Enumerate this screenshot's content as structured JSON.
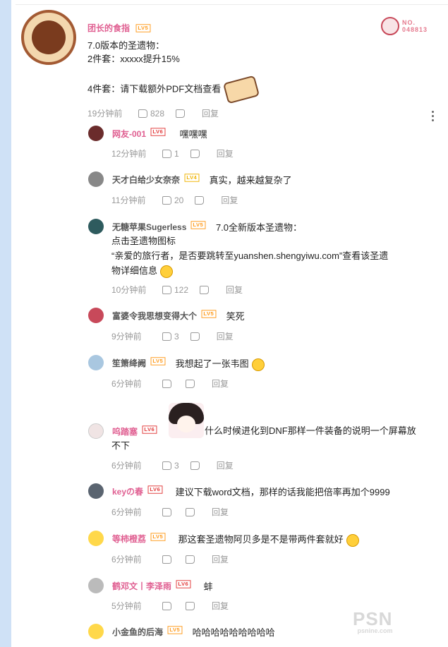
{
  "main": {
    "user": "团长的食指",
    "level": "LV5",
    "lines": [
      "7.0版本的圣遗物：",
      "2件套：xxxxx提升15%",
      "4件套：请下载额外PDF文档查看"
    ],
    "time": "19分钟前",
    "likes": "828",
    "reply_label": "回复",
    "badge_no": "NO.",
    "badge_num": "048813"
  },
  "replies": [
    {
      "user": "网友-001",
      "level": "LV6",
      "text": "嘿嘿嘿",
      "time": "12分钟前",
      "likes": "1",
      "reply_label": "回复"
    },
    {
      "user": "天才白给少女奈奈",
      "level": "LV4",
      "text": "真实，越来越复杂了",
      "time": "11分钟前",
      "likes": "20",
      "reply_label": "回复"
    },
    {
      "user": "无糖苹果Sugerless",
      "level": "LV5",
      "text": "7.0全新版本圣遗物：",
      "text2": "点击圣遗物图标",
      "text3": "“亲爱的旅行者，是否要跳转至yuanshen.shengyiwu.com”查看该圣遗",
      "text4": "物详细信息",
      "time": "10分钟前",
      "likes": "122",
      "reply_label": "回复"
    },
    {
      "user": "富婆令我思想变得大个",
      "level": "LV5",
      "text": "笑死",
      "time": "9分钟前",
      "likes": "3",
      "reply_label": "回复"
    },
    {
      "user": "笙箫绛阙",
      "level": "LV5",
      "text": "我想起了一张韦图",
      "time": "6分钟前",
      "likes": "",
      "reply_label": "回复"
    },
    {
      "user": "呜踏塞",
      "level": "LV6",
      "text": "什么时候进化到DNF那样一件装备的说明一个屏幕放",
      "text2": "不下",
      "time": "6分钟前",
      "likes": "3",
      "reply_label": "回复"
    },
    {
      "user": "keyの春",
      "level": "LV6",
      "text": "建议下载word文档，那样的话我能把倍率再加个9999",
      "time": "6分钟前",
      "likes": "",
      "reply_label": "回复"
    },
    {
      "user": "等柿橙荔",
      "level": "LV5",
      "text": "那这套圣遗物阿贝多是不是带两件套就好",
      "time": "6分钟前",
      "likes": "",
      "reply_label": "回复"
    },
    {
      "user": "鹤邓文丨李泽雨",
      "level": "LV6",
      "text": "蚌",
      "time": "5分钟前",
      "likes": "",
      "reply_label": "回复"
    },
    {
      "user": "小金鱼的后海",
      "level": "LV5",
      "text": "哈哈哈哈哈哈哈哈哈"
    }
  ],
  "watermark": {
    "brand": "PSN",
    "site": "psnine.com"
  },
  "colors": {
    "accent": "#e06092",
    "sidebar": "#cfe1f6"
  }
}
